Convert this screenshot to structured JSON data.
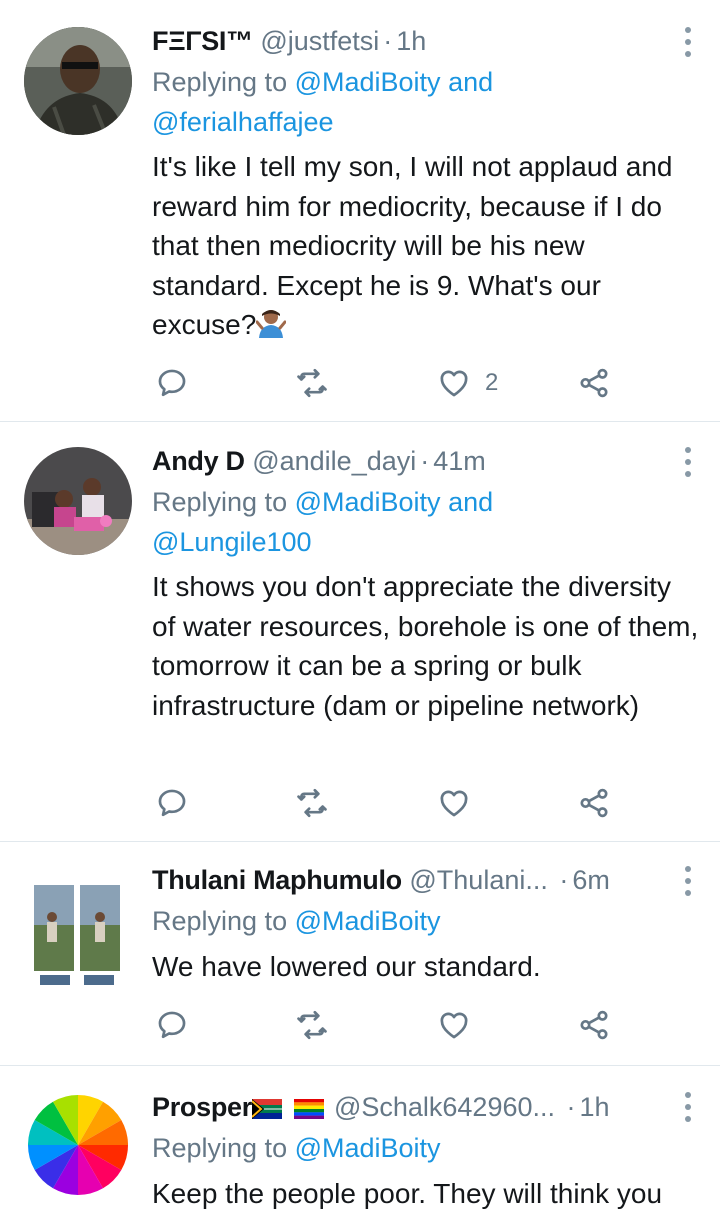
{
  "tweets": [
    {
      "display_name": "FΞΓSI™",
      "handle": "@justfetsi",
      "time": "1h",
      "replying_prefix": "Replying to ",
      "replying_to": "@MadiBoity",
      "replying_and": " and",
      "replying_to_2": "@ferialhaffajee",
      "text": "It's like I tell my son, I will not applaud and reward him for mediocrity, because if I do that then mediocrity will be his new standard. Except he is 9. What's our excuse?",
      "emoji": "person-shrugging",
      "likes": "2"
    },
    {
      "display_name": "Andy D",
      "handle": "@andile_dayi",
      "time": "41m",
      "replying_prefix": "Replying to ",
      "replying_to": "@MadiBoity",
      "replying_and": " and",
      "replying_to_2": "@Lungile100",
      "text": "It shows you don't appreciate the diversity of water resources, borehole is one of them, tomorrow it can be a spring or bulk infrastructure (dam or pipeline network)",
      "likes": ""
    },
    {
      "display_name": "Thulani Maphumulo",
      "handle": "@Thulani...",
      "time": "6m",
      "replying_prefix": "Replying to ",
      "replying_to": "@MadiBoity",
      "text": "We have lowered our standard.",
      "likes": ""
    },
    {
      "display_name": "Prosper",
      "name_flags": [
        "south-africa-flag",
        "rainbow-flag"
      ],
      "handle": "@Schalk642960...",
      "time": "1h",
      "replying_prefix": "Replying to ",
      "replying_to": "@MadiBoity",
      "text": "Keep the people poor. They will think you"
    }
  ],
  "icons": [
    "reply-icon",
    "retweet-icon",
    "like-icon",
    "share-icon",
    "more-icon"
  ],
  "colors": {
    "name": "#14171a",
    "secondary": "#657786",
    "mention": "#1b95e0",
    "divider": "#e1e8ed",
    "icon": "#657786"
  }
}
